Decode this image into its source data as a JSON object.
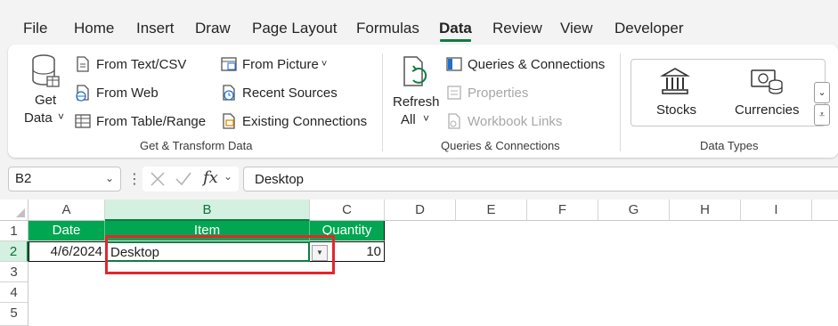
{
  "menu": {
    "tabs": [
      "File",
      "Home",
      "Insert",
      "Draw",
      "Page Layout",
      "Formulas",
      "Data",
      "Review",
      "View",
      "Developer"
    ],
    "active": "Data"
  },
  "ribbon": {
    "get_data": {
      "line1": "Get",
      "line2": "Data",
      "chevron": "˅"
    },
    "from_text_csv": "From Text/CSV",
    "from_web": "From Web",
    "from_table_range": "From Table/Range",
    "from_picture": "From Picture",
    "recent_sources": "Recent Sources",
    "existing_connections": "Existing Connections",
    "group_get_transform": "Get & Transform Data",
    "refresh_all": {
      "line1": "Refresh",
      "line2": "All"
    },
    "queries_connections": "Queries & Connections",
    "properties": "Properties",
    "workbook_links": "Workbook Links",
    "group_queries": "Queries & Connections",
    "stocks": "Stocks",
    "currencies": "Currencies",
    "group_data_types": "Data Types"
  },
  "formula_bar": {
    "name_box": "B2",
    "fx": "fx",
    "value": "Desktop"
  },
  "sheet": {
    "columns": [
      "A",
      "B",
      "C",
      "D",
      "E",
      "F",
      "G",
      "H",
      "I"
    ],
    "rows": [
      "1",
      "2",
      "3",
      "4",
      "5"
    ],
    "headers": [
      "Date",
      "Item",
      "Quantity"
    ],
    "row2": {
      "date": "4/6/2024",
      "item": "Desktop",
      "quantity": "10"
    },
    "colors": {
      "header_fill": "#00a651",
      "accent": "#107c41",
      "highlight_box": "#e3262d"
    }
  }
}
